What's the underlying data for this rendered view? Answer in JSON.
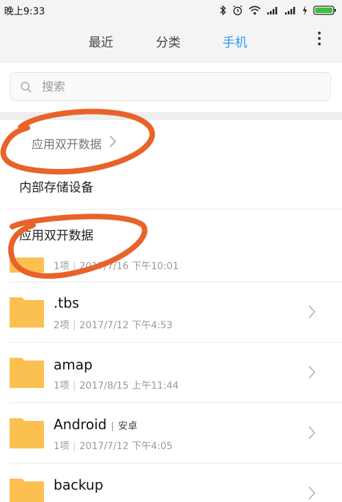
{
  "status": {
    "time": "晚上9:33",
    "icons": [
      "bluetooth-icon",
      "alarm-icon",
      "wifi-icon",
      "signal-icon",
      "signal-icon",
      "charging-icon",
      "battery-icon"
    ],
    "battery_color": "#3cc13c"
  },
  "tabs": [
    {
      "label": "最近",
      "active": false
    },
    {
      "label": "分类",
      "active": false
    },
    {
      "label": "手机",
      "active": true
    }
  ],
  "accent_color": "#2f9bf0",
  "search": {
    "placeholder": "搜索"
  },
  "breadcrumb": {
    "label": "应用双开数据"
  },
  "storage_item": {
    "label": "内部存储设备"
  },
  "app_clone_item": {
    "label": "应用双开数据"
  },
  "files": [
    {
      "name": "",
      "count": "1项",
      "date": "2017/7/16 下午10:01"
    },
    {
      "name": ".tbs",
      "count": "2项",
      "date": "2017/7/12 下午4:53"
    },
    {
      "name": "amap",
      "count": "1项",
      "date": "2017/8/15 上午11:44"
    },
    {
      "name": "Android",
      "tag": "安卓",
      "count": "1项",
      "date": "2017/7/12 下午4:05"
    },
    {
      "name": "backup",
      "count": "",
      "date": ""
    }
  ],
  "annotation_color": "#e8632a",
  "folder_color": "#fbc04f"
}
